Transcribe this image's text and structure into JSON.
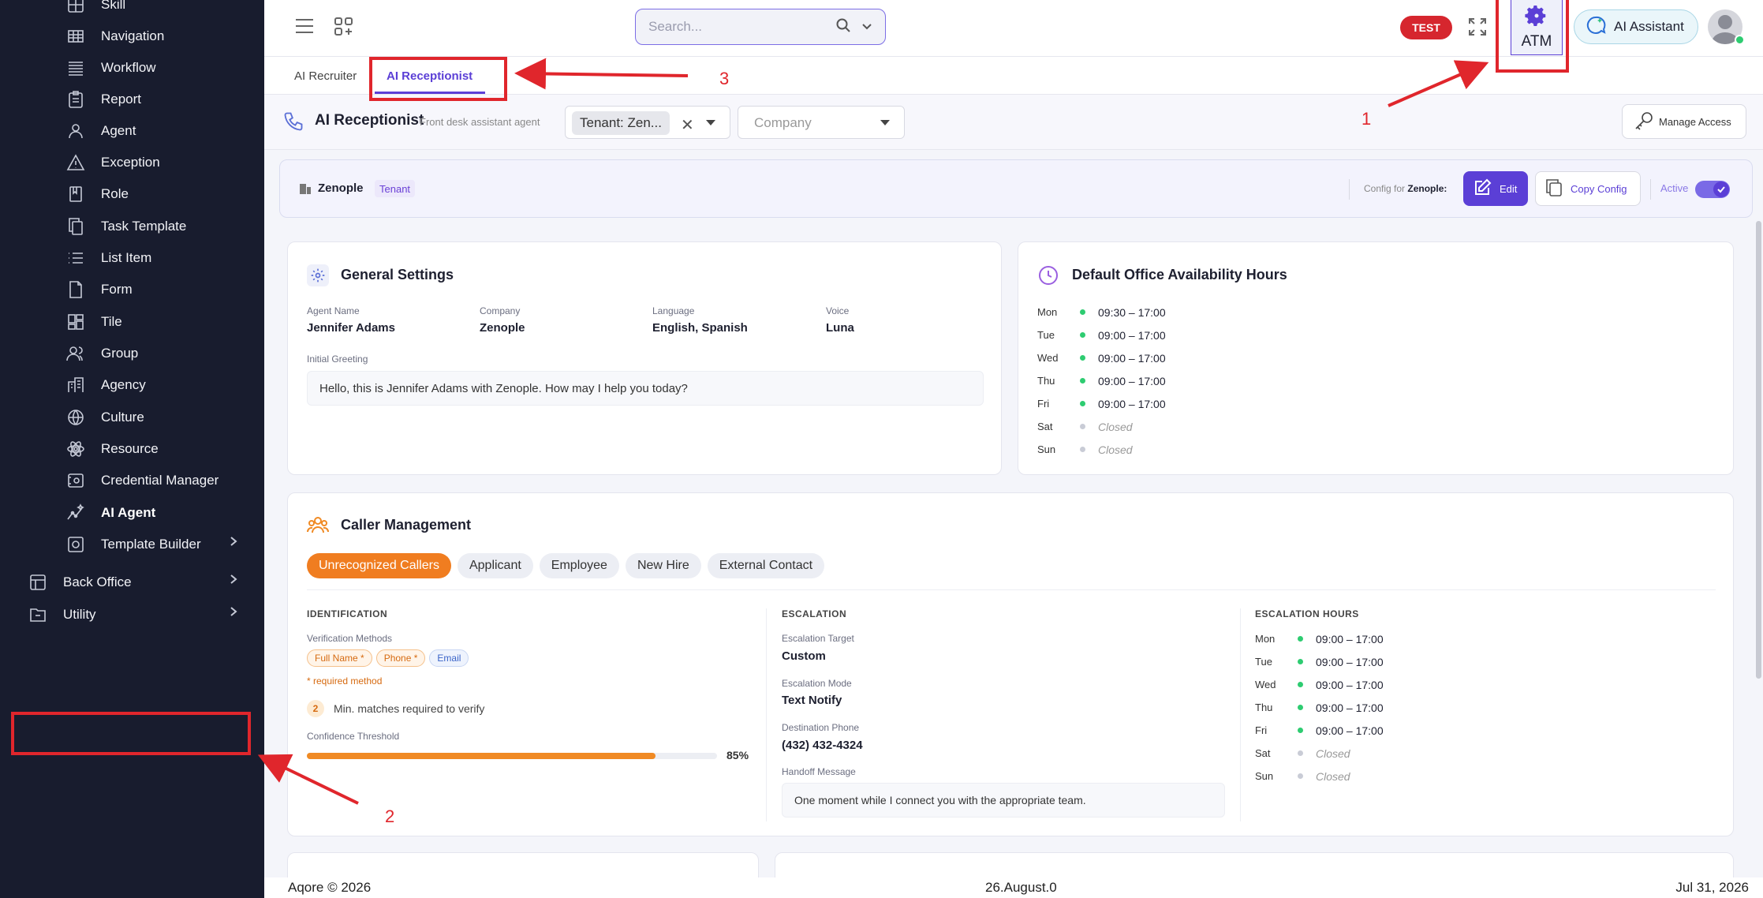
{
  "sidebar": {
    "items": [
      {
        "label": "Skill",
        "icon": "grid-icon"
      },
      {
        "label": "Navigation",
        "icon": "table-icon"
      },
      {
        "label": "Workflow",
        "icon": "lines-icon"
      },
      {
        "label": "Report",
        "icon": "clipboard-icon"
      },
      {
        "label": "Agent",
        "icon": "person-icon"
      },
      {
        "label": "Exception",
        "icon": "warning-icon"
      },
      {
        "label": "Role",
        "icon": "bookmark-icon"
      },
      {
        "label": "Task Template",
        "icon": "copy-icon"
      },
      {
        "label": "List Item",
        "icon": "list-icon"
      },
      {
        "label": "Form",
        "icon": "file-icon"
      },
      {
        "label": "Tile",
        "icon": "tiles-icon"
      },
      {
        "label": "Group",
        "icon": "group-icon"
      },
      {
        "label": "Agency",
        "icon": "building-icon"
      },
      {
        "label": "Culture",
        "icon": "globe-icon"
      },
      {
        "label": "Resource",
        "icon": "atom-icon"
      },
      {
        "label": "Credential Manager",
        "icon": "credential-icon"
      },
      {
        "label": "AI Agent",
        "icon": "ai-agent-icon"
      },
      {
        "label": "Template Builder",
        "icon": "gear-icon"
      },
      {
        "label": "Back Office",
        "icon": "backoffice-icon"
      },
      {
        "label": "Utility",
        "icon": "folder-icon"
      }
    ]
  },
  "topbar": {
    "search_placeholder": "Search...",
    "env_badge": "TEST",
    "atm_label": "ATM",
    "ai_assistant_label": "AI Assistant"
  },
  "tabs": [
    "AI Recruiter",
    "AI Receptionist"
  ],
  "subheader": {
    "title": "AI Receptionist",
    "subtitle": "Front desk assistant agent",
    "tenant_chip": "Tenant: Zen...",
    "company_placeholder": "Company",
    "manage_access": "Manage Access"
  },
  "tenant_bar": {
    "name": "Zenople",
    "badge": "Tenant",
    "config_for_label": "Config for",
    "config_for_name": "Zenople:",
    "edit_label": "Edit",
    "copy_label": "Copy Config",
    "active_label": "Active"
  },
  "general": {
    "title": "General Settings",
    "fields": [
      {
        "label": "Agent Name",
        "value": "Jennifer Adams"
      },
      {
        "label": "Company",
        "value": "Zenople"
      },
      {
        "label": "Language",
        "value": "English, Spanish"
      },
      {
        "label": "Voice",
        "value": "Luna"
      }
    ],
    "greeting_label": "Initial Greeting",
    "greeting": "Hello, this is Jennifer Adams with Zenople. How may I help you today?"
  },
  "office_hours": {
    "title": "Default Office Availability Hours",
    "rows": [
      {
        "day": "Mon",
        "time": "09:30 – 17:00",
        "open": true
      },
      {
        "day": "Tue",
        "time": "09:00 – 17:00",
        "open": true
      },
      {
        "day": "Wed",
        "time": "09:00 – 17:00",
        "open": true
      },
      {
        "day": "Thu",
        "time": "09:00 – 17:00",
        "open": true
      },
      {
        "day": "Fri",
        "time": "09:00 – 17:00",
        "open": true
      },
      {
        "day": "Sat",
        "time": "Closed",
        "open": false
      },
      {
        "day": "Sun",
        "time": "Closed",
        "open": false
      }
    ]
  },
  "caller": {
    "title": "Caller Management",
    "pills": [
      "Unrecognized Callers",
      "Applicant",
      "Employee",
      "New Hire",
      "External Contact"
    ],
    "identification": {
      "heading": "IDENTIFICATION",
      "methods_label": "Verification Methods",
      "methods": [
        "Full Name *",
        "Phone *",
        "Email"
      ],
      "required_note": "* required method",
      "min_matches": "2",
      "min_matches_label": "Min. matches required to verify",
      "confidence_label": "Confidence Threshold",
      "confidence_value": "85%",
      "confidence_fraction": 0.85
    },
    "escalation": {
      "heading": "ESCALATION",
      "target_label": "Escalation Target",
      "target": "Custom",
      "mode_label": "Escalation Mode",
      "mode": "Text Notify",
      "phone_label": "Destination Phone",
      "phone": "(432) 432-4324",
      "handoff_label": "Handoff Message",
      "handoff": "One moment while I connect you with the appropriate team."
    },
    "esc_hours": {
      "heading": "ESCALATION HOURS",
      "rows": [
        {
          "day": "Mon",
          "time": "09:00 – 17:00",
          "open": true
        },
        {
          "day": "Tue",
          "time": "09:00 – 17:00",
          "open": true
        },
        {
          "day": "Wed",
          "time": "09:00 – 17:00",
          "open": true
        },
        {
          "day": "Thu",
          "time": "09:00 – 17:00",
          "open": true
        },
        {
          "day": "Fri",
          "time": "09:00 – 17:00",
          "open": true
        },
        {
          "day": "Sat",
          "time": "Closed",
          "open": false
        },
        {
          "day": "Sun",
          "time": "Closed",
          "open": false
        }
      ]
    }
  },
  "annotations": [
    "1",
    "2",
    "3"
  ],
  "footer": {
    "left": "Aqore © 2026",
    "center": "26.August.0",
    "right": "Jul 31, 2026"
  },
  "colors": {
    "sidebar_bg": "#181c2e",
    "accent": "#5b3fd6",
    "orange": "#f08a24",
    "red_marker": "#e0262c"
  }
}
